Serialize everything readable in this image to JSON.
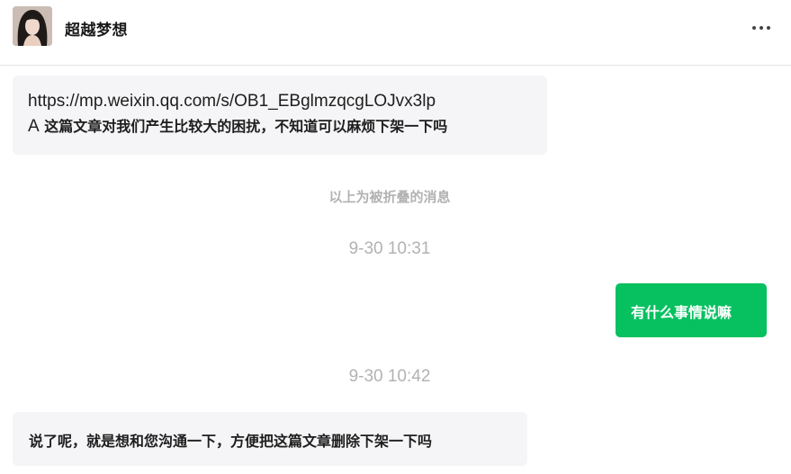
{
  "header": {
    "contact_name": "超越梦想",
    "avatar_icon": "avatar-photo",
    "more_icon": "more-dots-icon"
  },
  "messages": [
    {
      "direction": "incoming",
      "line1": "https://mp.weixin.qq.com/s/OB1_EBglmzqcgLOJvx3lp",
      "line2_lead": "A",
      "line2_text": "这篇文章对我们产生比较大的困扰，不知道可以麻烦下架一下吗"
    },
    {
      "direction": "system",
      "text": "以上为被折叠的消息"
    },
    {
      "direction": "timestamp",
      "text": "9-30 10:31"
    },
    {
      "direction": "outgoing",
      "text": "有什么事情说嘛"
    },
    {
      "direction": "timestamp",
      "text": "9-30 10:42"
    },
    {
      "direction": "incoming",
      "text": "说了呢，就是想和您沟通一下，方便把这篇文章删除下架一下吗"
    }
  ],
  "colors": {
    "outgoing_bubble": "#07c160",
    "incoming_bubble": "#f5f5f7",
    "system_text": "#b2b2b2"
  }
}
